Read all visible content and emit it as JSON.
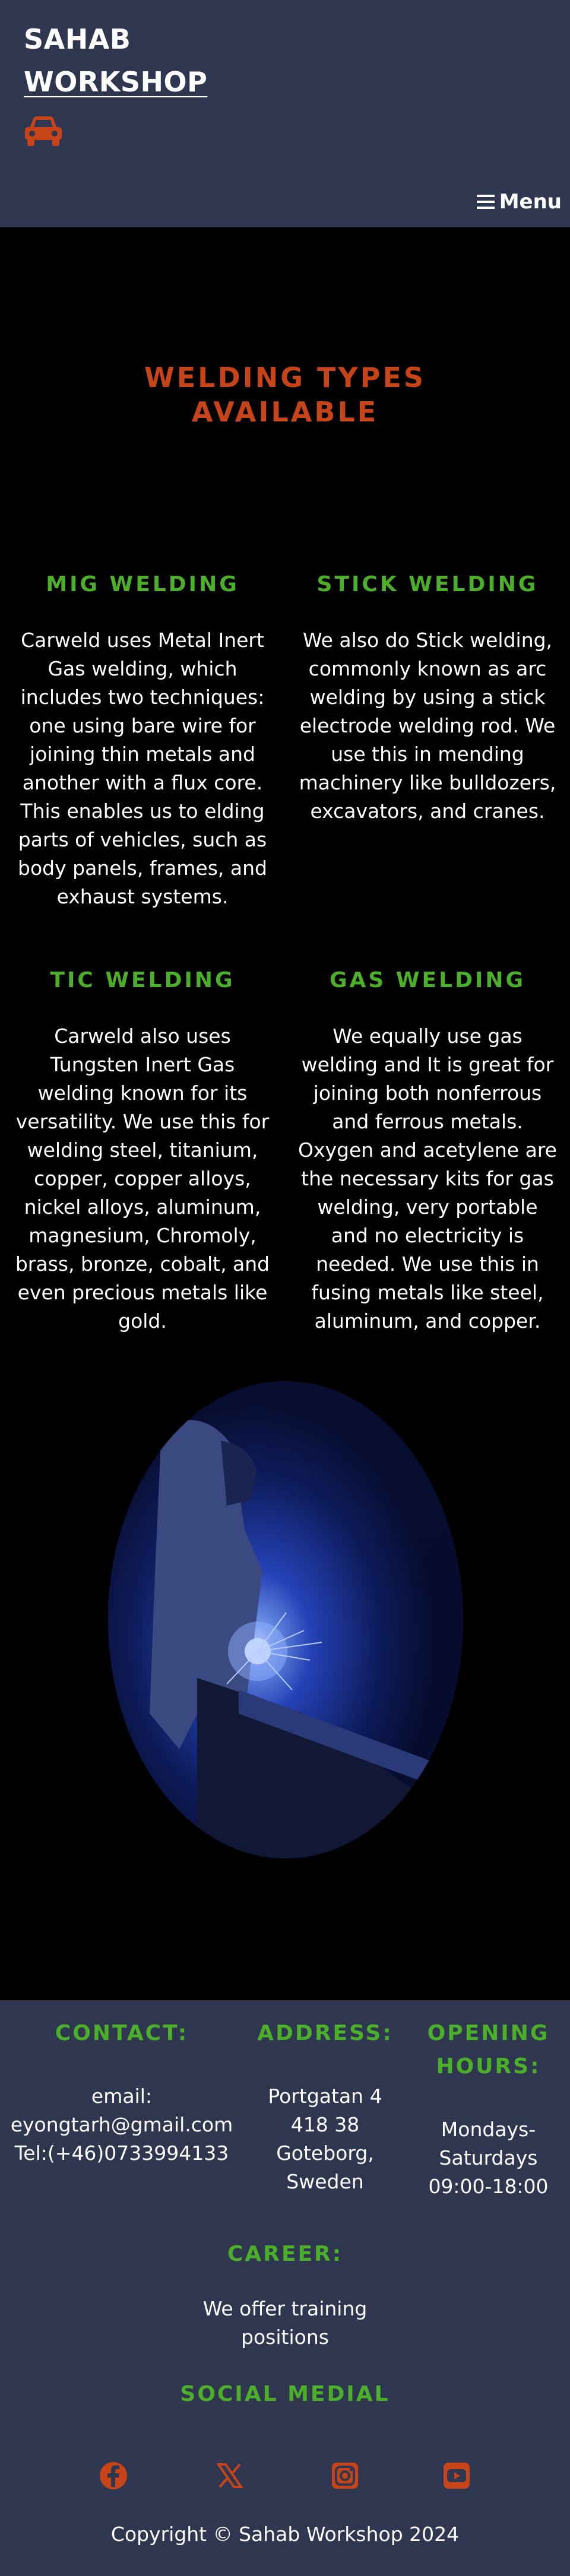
{
  "header": {
    "brand_line1": "SAHAB",
    "brand_line2": "WORKSHOP",
    "car_icon": "car-icon",
    "menu_label": "Menu",
    "menu_icon": "hamburger-icon"
  },
  "welding": {
    "title_line1": "WELDING TYPES",
    "title_line2": "AVAILABLE",
    "types": [
      {
        "title": "MIG WELDING",
        "text": "Carweld uses Metal Inert Gas welding, which includes two techniques: one using bare wire for joining thin metals and another with a flux core. This enables us to elding parts of vehicles, such as body panels, frames, and exhaust systems."
      },
      {
        "title": "STICK WELDING",
        "text": "We also do Stick welding, commonly known as arc welding by using a stick electrode welding rod. We use this in mending machinery like bulldozers, excavators, and cranes."
      },
      {
        "title": "TIC WELDING",
        "text": "Carweld also uses Tungsten Inert Gas welding known for its versatility. We use this for welding steel, titanium, copper, copper alloys, nickel alloys, aluminum, magnesium, Chromoly, brass, bronze, cobalt, and even precious metals like gold."
      },
      {
        "title": "GAS WELDING",
        "text": "We equally use gas welding and It is great for joining both nonferrous and ferrous metals. Oxygen and acetylene are the necessary kits for gas welding, very portable and no electricity is needed. We use this in fusing metals like steel, aluminum, and copper."
      }
    ]
  },
  "footer": {
    "contact_title": "CONTACT:",
    "contact_email": "email: eyongtarh@gmail.com",
    "contact_tel": "Tel:(+46)0733994133",
    "address_title": "ADDRESS:",
    "address_text": "Portgatan 4 418 38 Goteborg, Sweden",
    "hours_title": "OPENING HOURS:",
    "hours_text": "Mondays-Saturdays 09:00-18:00",
    "career_title": "CAREER:",
    "career_text": "We offer training positions",
    "social_title": "SOCIAL MEDIAL",
    "social_icons": [
      "facebook-icon",
      "x-icon",
      "instagram-icon",
      "youtube-icon"
    ],
    "copyright": "Copyright © Sahab Workshop 2024"
  },
  "colors": {
    "header_bg": "#2f3650",
    "accent_orange": "#c64418",
    "accent_green": "#4caf2a",
    "page_bg": "#000000"
  }
}
